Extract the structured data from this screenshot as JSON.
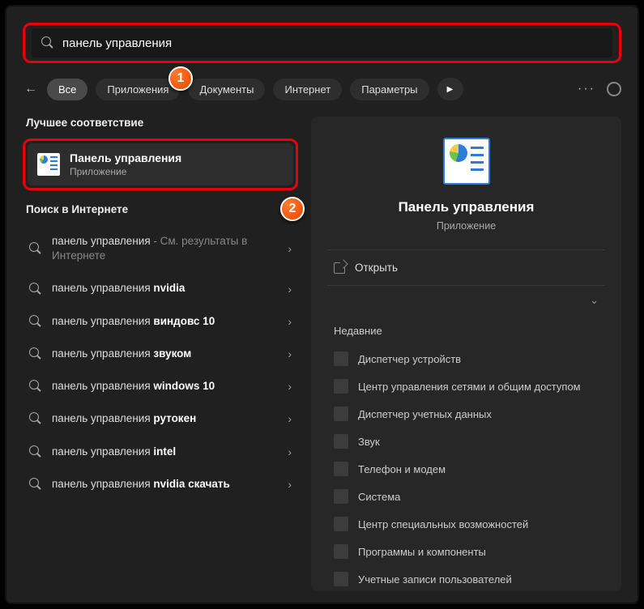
{
  "search": {
    "value": "панель управления"
  },
  "filters": {
    "items": [
      "Все",
      "Приложения",
      "Документы",
      "Интернет",
      "Параметры"
    ],
    "active_index": 0
  },
  "badges": {
    "one": "1",
    "two": "2"
  },
  "best_match": {
    "heading": "Лучшее соответствие",
    "title": "Панель управления",
    "subtitle": "Приложение"
  },
  "web_search": {
    "heading": "Поиск в Интернете",
    "items": [
      {
        "prefix": "панель управления",
        "bold": "",
        "suffix": " - См. результаты в Интернете",
        "dim_suffix": true
      },
      {
        "prefix": "панель управления ",
        "bold": "nvidia",
        "suffix": ""
      },
      {
        "prefix": "панель управления ",
        "bold": "виндовс 10",
        "suffix": ""
      },
      {
        "prefix": "панель управления ",
        "bold": "звуком",
        "suffix": ""
      },
      {
        "prefix": "панель управления ",
        "bold": "windows 10",
        "suffix": ""
      },
      {
        "prefix": "панель управления ",
        "bold": "рутокен",
        "suffix": ""
      },
      {
        "prefix": "панель управления ",
        "bold": "intel",
        "suffix": ""
      },
      {
        "prefix": "панель управления ",
        "bold": "nvidia скачать",
        "suffix": ""
      }
    ]
  },
  "details": {
    "title": "Панель управления",
    "subtitle": "Приложение",
    "open_label": "Открыть",
    "recent_heading": "Недавние",
    "recent_items": [
      "Диспетчер устройств",
      "Центр управления сетями и общим доступом",
      "Диспетчер учетных данных",
      "Звук",
      "Телефон и модем",
      "Система",
      "Центр специальных возможностей",
      "Программы и компоненты",
      "Учетные записи пользователей"
    ]
  }
}
